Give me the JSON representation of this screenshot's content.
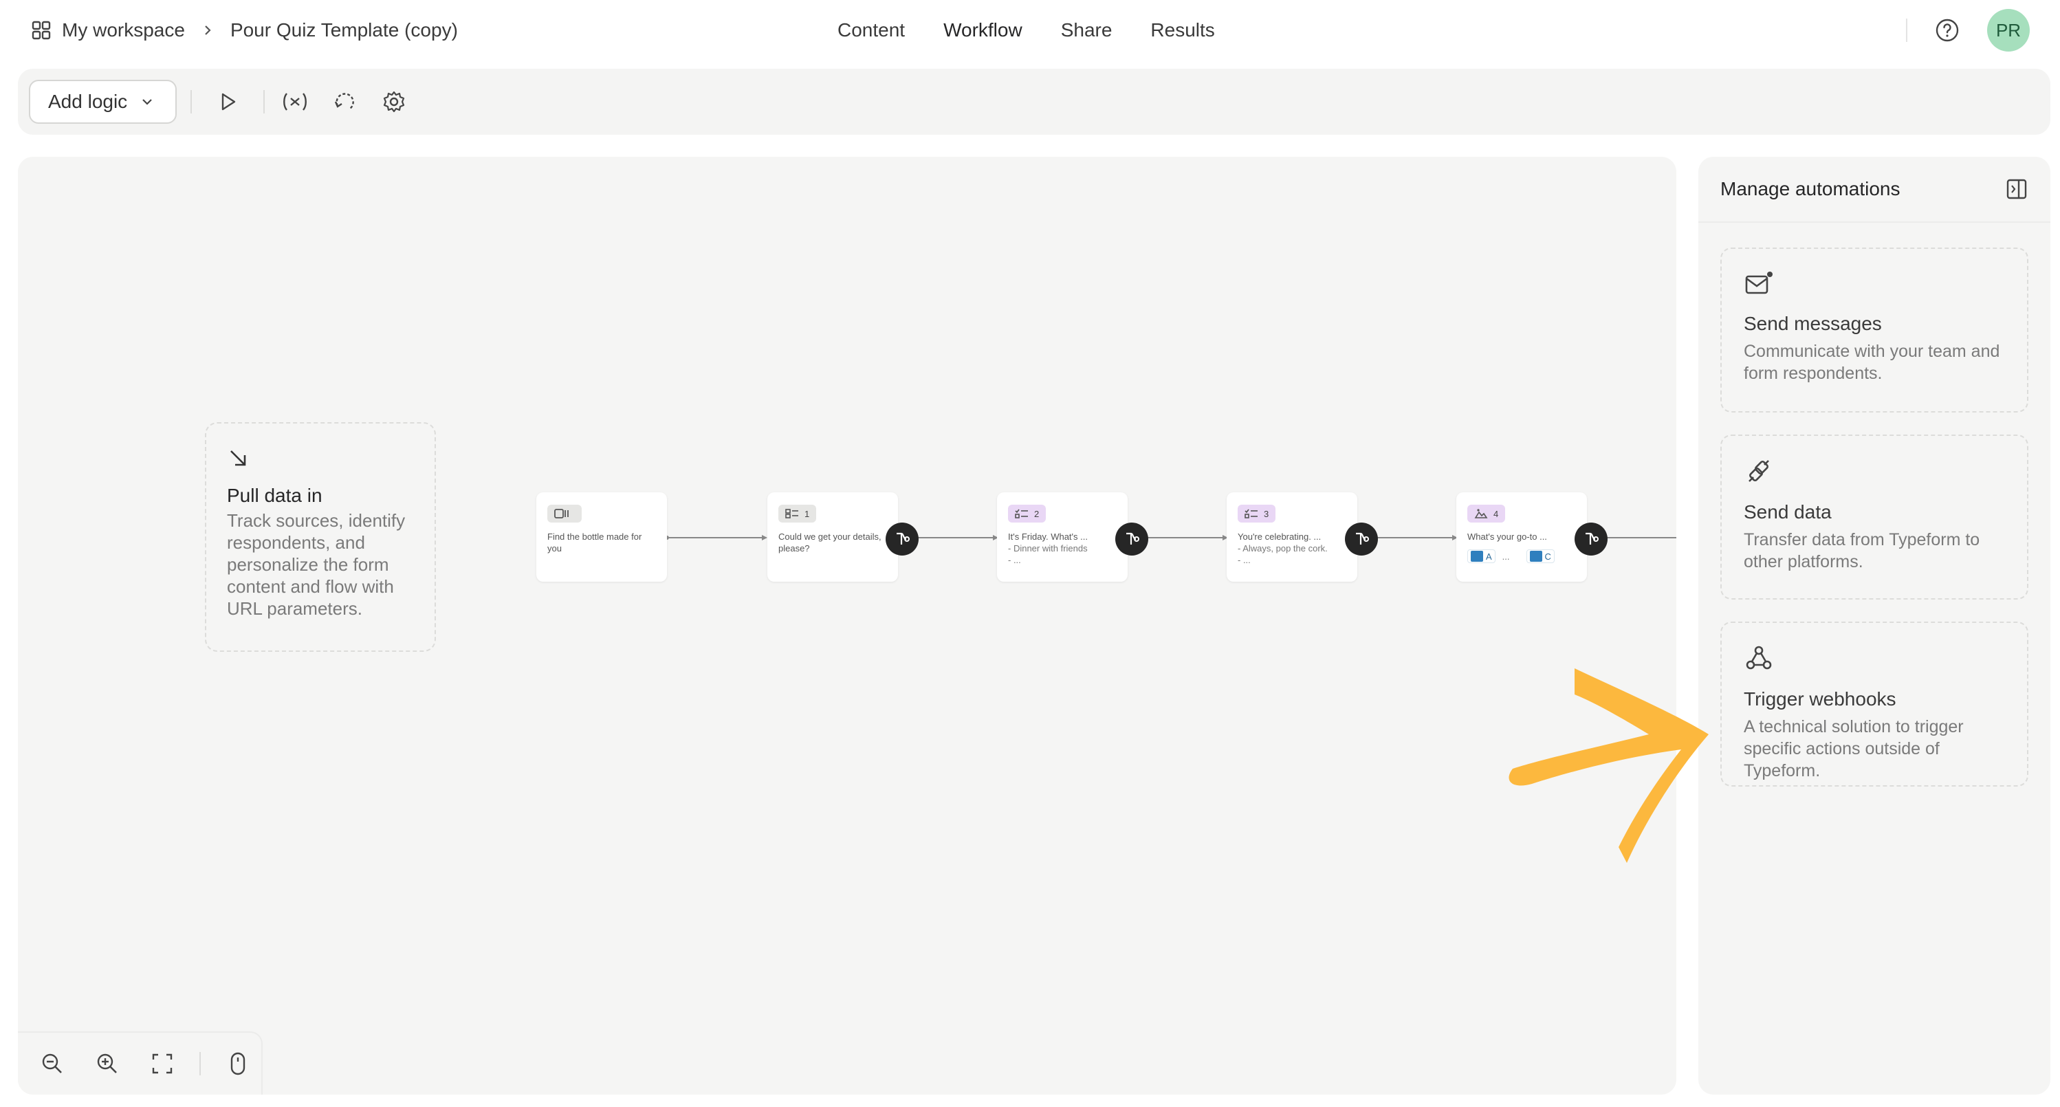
{
  "breadcrumb": {
    "workspace": "My workspace",
    "form": "Pour Quiz Template (copy)"
  },
  "nav": {
    "tabs": [
      "Content",
      "Workflow",
      "Share",
      "Results"
    ],
    "active": "Workflow"
  },
  "user": {
    "initials": "PR"
  },
  "toolbar": {
    "add_logic_label": "Add logic"
  },
  "canvas": {
    "pull_card": {
      "title": "Pull data in",
      "description": "Track sources, identify respondents, and personalize the form content and flow with URL parameters."
    },
    "nodes": [
      {
        "badge": "",
        "text": "Find the bottle made for you"
      },
      {
        "badge": "1",
        "text": "Could we get your details, please?"
      },
      {
        "badge": "2",
        "text": "It's Friday. What's ...",
        "sub1": "- Dinner with friends",
        "sub2": "- ..."
      },
      {
        "badge": "3",
        "text": "You're celebrating. ...",
        "sub1": "- Always, pop the cork.",
        "sub2": "- ..."
      },
      {
        "badge": "4",
        "text": "What's your go-to ...",
        "pic_a": "A",
        "ellipsis": "...",
        "pic_c": "C"
      }
    ]
  },
  "panel": {
    "title": "Manage automations",
    "cards": [
      {
        "title": "Send messages",
        "description": "Communicate with your team and form respondents.",
        "icon": "mail-icon"
      },
      {
        "title": "Send data",
        "description": "Transfer data from Typeform to other platforms.",
        "icon": "plug-icon"
      },
      {
        "title": "Trigger webhooks",
        "description": "A technical solution to trigger specific actions outside of Typeform.",
        "icon": "webhook-icon"
      }
    ]
  },
  "colors": {
    "accent_arrow": "#fcb83e",
    "avatar_bg": "#a6dfbd",
    "badge_purple": "#e9d7f5"
  }
}
